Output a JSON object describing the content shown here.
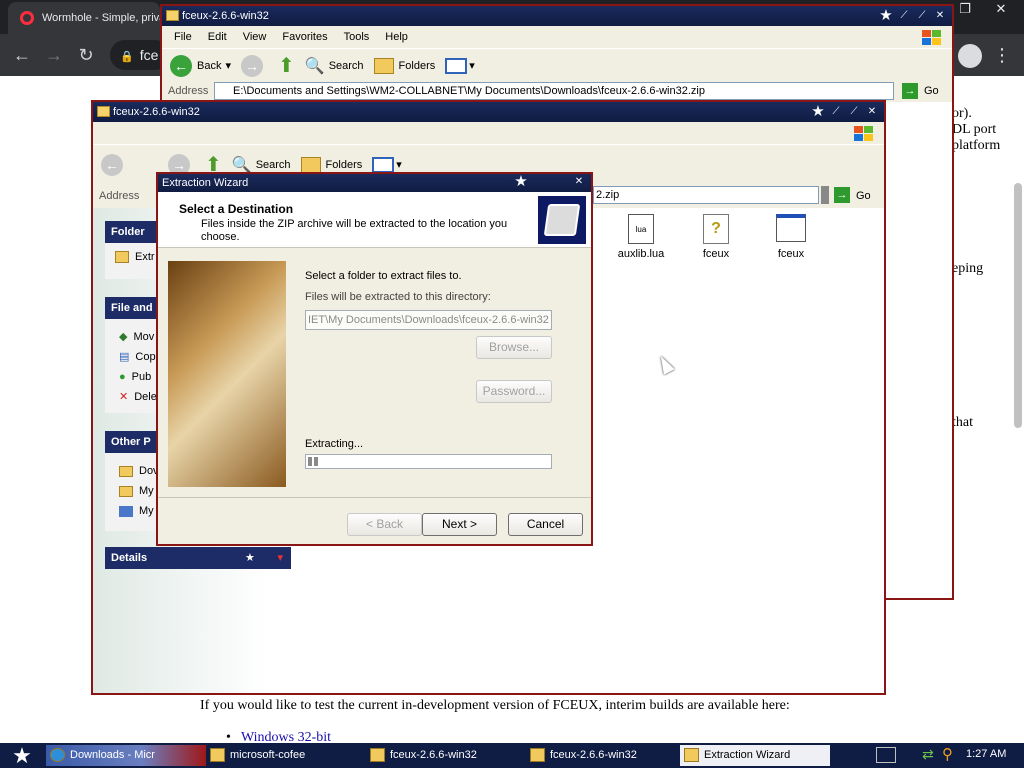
{
  "browser": {
    "tab_title": "Wormhole - Simple, priva",
    "omnibox_text": "fce",
    "page_text": {
      "right_fragments": [
        "or).",
        "DL port",
        "platform",
        "eping",
        "that"
      ],
      "interim_sentence": "If you would like to test the current in-development version of FCEUX, interim builds are available here:",
      "link_windows": "Windows 32-bit"
    }
  },
  "window_back": {
    "title": "fceux-2.6.6-win32",
    "menu": [
      "File",
      "Edit",
      "View",
      "Favorites",
      "Tools",
      "Help"
    ],
    "toolbar": {
      "back": "Back",
      "search": "Search",
      "folders": "Folders"
    },
    "address_label": "Address",
    "address_value": "E:\\Documents and Settings\\WM2-COLLABNET\\My Documents\\Downloads\\fceux-2.6.6-win32.zip",
    "go": "Go"
  },
  "window_front": {
    "title": "fceux-2.6.6-win32",
    "toolbar": {
      "back": "Back",
      "search": "Search",
      "folders": "Folders"
    },
    "address_label": "Address",
    "address_value": "2.zip",
    "go": "Go",
    "files": [
      "auxlib.lua",
      "fceux",
      "fceux"
    ],
    "side_panels": {
      "folder": {
        "header": "Folder",
        "items": [
          "Extr"
        ]
      },
      "file_and": {
        "header": "File and",
        "items": [
          "Mov",
          "Cop",
          "Pub",
          "Dele"
        ]
      },
      "other": {
        "header": "Other P",
        "items": [
          "Dov",
          "My",
          "My"
        ]
      },
      "details": {
        "header": "Details"
      }
    }
  },
  "wizard": {
    "title": "Extraction Wizard",
    "heading": "Select a Destination",
    "subheading": "Files inside the ZIP archive will be extracted to the location you choose.",
    "instruction": "Select a folder to extract files to.",
    "dir_label": "Files will be extracted to this directory:",
    "dir_value": "IET\\My Documents\\Downloads\\fceux-2.6.6-win32",
    "browse": "Browse...",
    "password": "Password...",
    "extracting": "Extracting...",
    "progress": 0.05,
    "back": "< Back",
    "next": "Next >",
    "cancel": "Cancel"
  },
  "taskbar": {
    "items": [
      "Downloads - Micr",
      "microsoft-cofee",
      "fceux-2.6.6-win32",
      "fceux-2.6.6-win32",
      "Extraction Wizard"
    ],
    "clock": "1:27 AM"
  },
  "colors": {
    "xp_titlebar": "#15245a",
    "panel_header": "#1d2c66",
    "explorer_bg": "#f1efe2",
    "accent_red": "#a01818"
  }
}
